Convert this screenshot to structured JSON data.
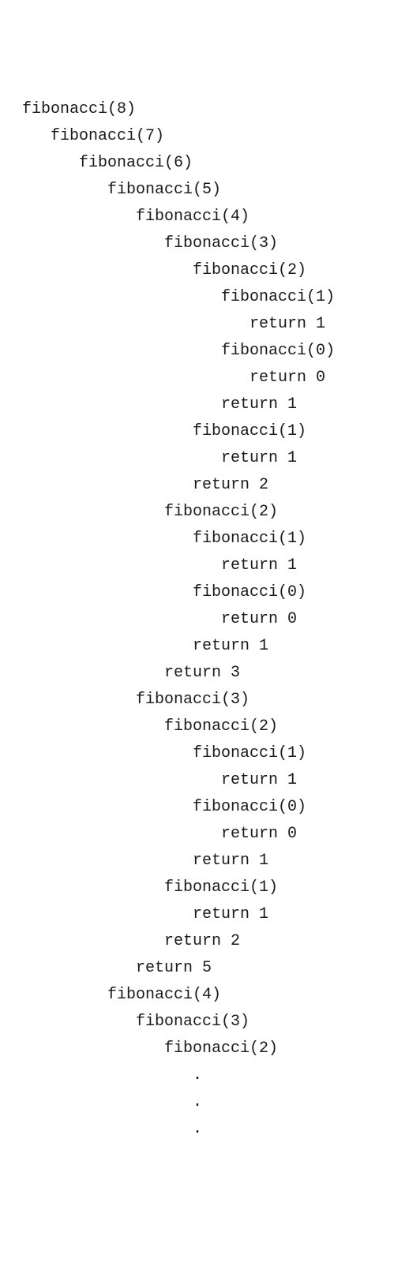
{
  "trace": {
    "indent_unit": "   ",
    "lines": [
      {
        "depth": 0,
        "text": "fibonacci(8)"
      },
      {
        "depth": 1,
        "text": "fibonacci(7)"
      },
      {
        "depth": 2,
        "text": "fibonacci(6)"
      },
      {
        "depth": 3,
        "text": "fibonacci(5)"
      },
      {
        "depth": 4,
        "text": "fibonacci(4)"
      },
      {
        "depth": 5,
        "text": "fibonacci(3)"
      },
      {
        "depth": 6,
        "text": "fibonacci(2)"
      },
      {
        "depth": 7,
        "text": "fibonacci(1)"
      },
      {
        "depth": 8,
        "text": "return 1"
      },
      {
        "depth": 7,
        "text": "fibonacci(0)"
      },
      {
        "depth": 8,
        "text": "return 0"
      },
      {
        "depth": 7,
        "text": "return 1"
      },
      {
        "depth": 6,
        "text": "fibonacci(1)"
      },
      {
        "depth": 7,
        "text": "return 1"
      },
      {
        "depth": 6,
        "text": "return 2"
      },
      {
        "depth": 5,
        "text": "fibonacci(2)"
      },
      {
        "depth": 6,
        "text": "fibonacci(1)"
      },
      {
        "depth": 7,
        "text": "return 1"
      },
      {
        "depth": 6,
        "text": "fibonacci(0)"
      },
      {
        "depth": 7,
        "text": "return 0"
      },
      {
        "depth": 6,
        "text": "return 1"
      },
      {
        "depth": 5,
        "text": "return 3"
      },
      {
        "depth": 4,
        "text": "fibonacci(3)"
      },
      {
        "depth": 5,
        "text": "fibonacci(2)"
      },
      {
        "depth": 6,
        "text": "fibonacci(1)"
      },
      {
        "depth": 7,
        "text": "return 1"
      },
      {
        "depth": 6,
        "text": "fibonacci(0)"
      },
      {
        "depth": 7,
        "text": "return 0"
      },
      {
        "depth": 6,
        "text": "return 1"
      },
      {
        "depth": 5,
        "text": "fibonacci(1)"
      },
      {
        "depth": 6,
        "text": "return 1"
      },
      {
        "depth": 5,
        "text": "return 2"
      },
      {
        "depth": 4,
        "text": "return 5"
      },
      {
        "depth": 3,
        "text": "fibonacci(4)"
      },
      {
        "depth": 4,
        "text": "fibonacci(3)"
      },
      {
        "depth": 5,
        "text": "fibonacci(2)"
      },
      {
        "depth": 6,
        "text": "."
      },
      {
        "depth": 6,
        "text": "."
      },
      {
        "depth": 6,
        "text": "."
      }
    ]
  }
}
